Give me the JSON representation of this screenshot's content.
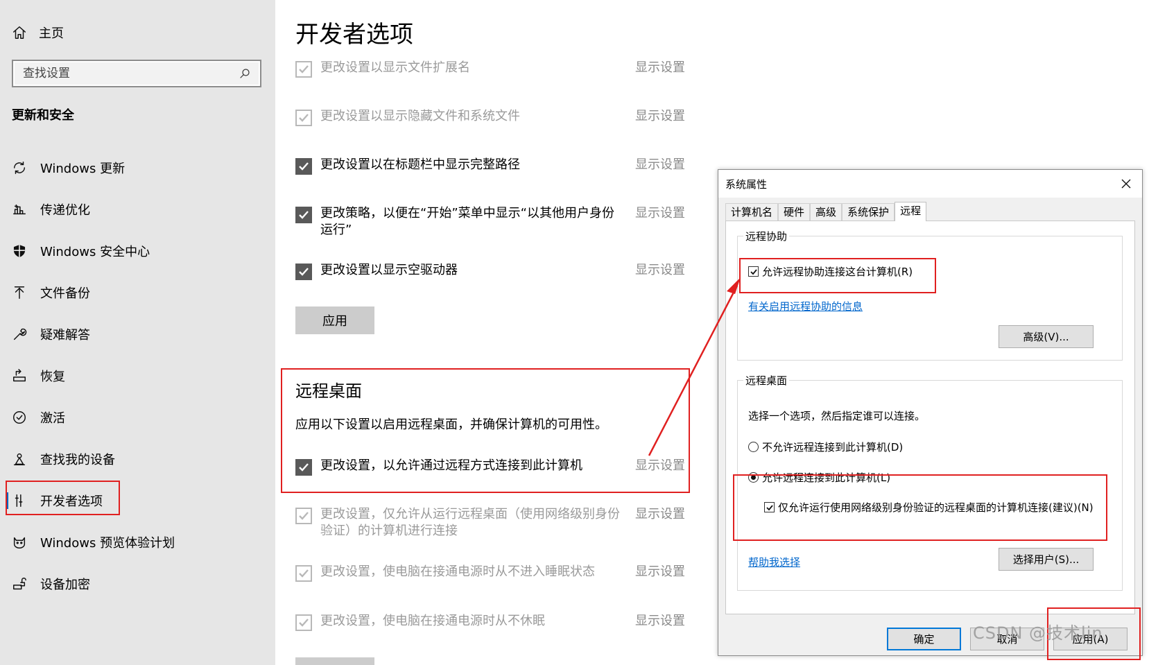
{
  "sidebar": {
    "home_label": "主页",
    "search_placeholder": "查找设置",
    "section_title": "更新和安全",
    "items": [
      {
        "label": "Windows 更新",
        "icon": "refresh-icon"
      },
      {
        "label": "传递优化",
        "icon": "delivery-optimization-icon"
      },
      {
        "label": "Windows 安全中心",
        "icon": "shield-icon"
      },
      {
        "label": "文件备份",
        "icon": "backup-arrow-icon"
      },
      {
        "label": "疑难解答",
        "icon": "wrench-icon"
      },
      {
        "label": "恢复",
        "icon": "recovery-icon"
      },
      {
        "label": "激活",
        "icon": "check-circle-icon"
      },
      {
        "label": "查找我的设备",
        "icon": "find-device-icon"
      },
      {
        "label": "开发者选项",
        "icon": "developer-icon",
        "selected": true
      },
      {
        "label": "Windows 预览体验计划",
        "icon": "insider-cat-icon"
      },
      {
        "label": "设备加密",
        "icon": "encryption-icon"
      }
    ]
  },
  "main": {
    "title": "开发者选项",
    "show_settings_label": "显示设置",
    "file_options": [
      {
        "text": "更改设置以显示文件扩展名",
        "checked": true,
        "enabled": false
      },
      {
        "text": "更改设置以显示隐藏文件和系统文件",
        "checked": true,
        "enabled": false
      },
      {
        "text": "更改设置以在标题栏中显示完整路径",
        "checked": true,
        "enabled": true
      },
      {
        "text": "更改策略，以便在“开始”菜单中显示“以其他用户身份运行”",
        "checked": true,
        "enabled": true
      },
      {
        "text": "更改设置以显示空驱动器",
        "checked": true,
        "enabled": true
      }
    ],
    "apply_label": "应用",
    "remote_desktop": {
      "title": "远程桌面",
      "description": "应用以下设置以启用远程桌面，并确保计算机的可用性。",
      "options": [
        {
          "text": "更改设置，以允许通过远程方式连接到此计算机",
          "checked": true,
          "enabled": true
        },
        {
          "text": "更改设置，仅允许从运行远程桌面（使用网络级别身份验证）的计算机进行连接",
          "checked": true,
          "enabled": false
        },
        {
          "text": "更改设置，使电脑在接通电源时从不进入睡眠状态",
          "checked": true,
          "enabled": false
        },
        {
          "text": "更改设置，使电脑在接通电源时从不休眠",
          "checked": true,
          "enabled": false
        }
      ]
    }
  },
  "dialog": {
    "title": "系统属性",
    "tabs": [
      "计算机名",
      "硬件",
      "高级",
      "系统保护",
      "远程"
    ],
    "active_tab": "远程",
    "remote_assistance": {
      "group_label": "远程协助",
      "allow_label": "允许远程协助连接这台计算机(R)",
      "allow_checked": true,
      "info_link": "有关启用远程协助的信息",
      "advanced_button": "高级(V)..."
    },
    "remote_desktop": {
      "group_label": "远程桌面",
      "instruction": "选择一个选项，然后指定谁可以连接。",
      "option_deny": "不允许远程连接到此计算机(D)",
      "option_allow": "允许远程连接到此计算机(L)",
      "selected": "allow",
      "nla_label": "仅允许运行使用网络级别身份验证的远程桌面的计算机连接(建议)(N)",
      "nla_checked": true,
      "help_link": "帮助我选择",
      "select_users_button": "选择用户(S)..."
    },
    "buttons": {
      "ok": "确定",
      "cancel": "取消",
      "apply": "应用(A)"
    }
  },
  "annotation_color": "#e02020",
  "watermark": "CSDN @技术lin"
}
